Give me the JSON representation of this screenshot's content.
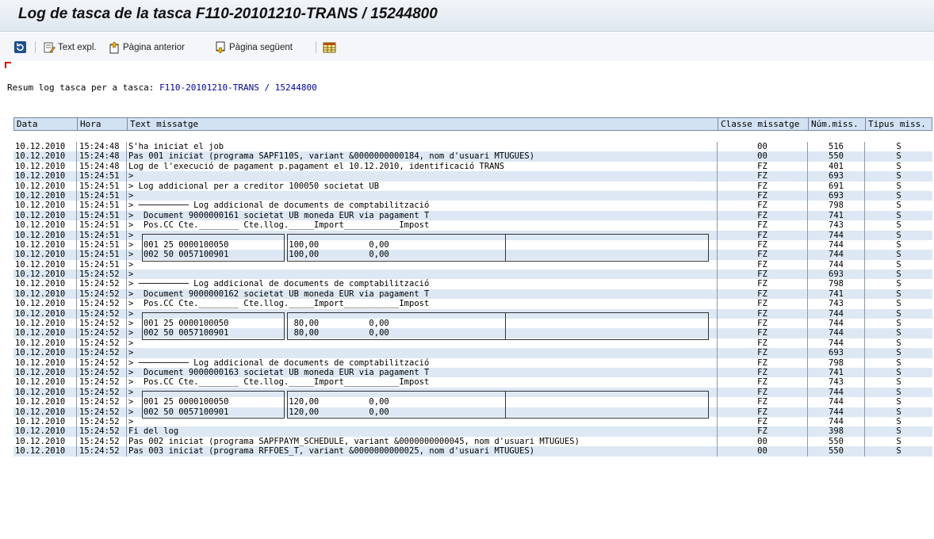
{
  "window": {
    "title": "Log de tasca de la tasca F110-20101210-TRANS / 15244800"
  },
  "toolbar": {
    "refresh_icon": "refresh-icon",
    "text_expl": "Text expl.",
    "prev_page": "Pàgina anterior",
    "next_page": "Pàgina següent",
    "grid_icon": "grid-icon"
  },
  "summary": {
    "label": "Resum log tasca per a tasca: ",
    "value": "F110-20101210-TRANS / 15244800"
  },
  "columns": [
    "Data",
    "Hora",
    "Text missatge",
    "Classe missatge",
    "Núm.miss.",
    "Tipus miss."
  ],
  "rows": [
    {
      "date": "10.12.2010",
      "time": "15:24:48",
      "text": "S'ha iniciat el job",
      "cls": "00",
      "num": "516",
      "type": "S"
    },
    {
      "date": "10.12.2010",
      "time": "15:24:48",
      "text": "Pas 001 iniciat (programa SAPF110S, variant &0000000000184, nom d'usuari MTUGUES)",
      "cls": "00",
      "num": "550",
      "type": "S"
    },
    {
      "date": "10.12.2010",
      "time": "15:24:48",
      "text": "Log de l'execució de pagament p.pagament el 10.12.2010, identificació TRANS",
      "cls": "FZ",
      "num": "401",
      "type": "S"
    },
    {
      "date": "10.12.2010",
      "time": "15:24:51",
      "text": ">",
      "cls": "FZ",
      "num": "693",
      "type": "S"
    },
    {
      "date": "10.12.2010",
      "time": "15:24:51",
      "text": "> Log addicional per a creditor 100050 societat UB",
      "cls": "FZ",
      "num": "691",
      "type": "S"
    },
    {
      "date": "10.12.2010",
      "time": "15:24:51",
      "text": ">",
      "cls": "FZ",
      "num": "693",
      "type": "S"
    },
    {
      "date": "10.12.2010",
      "time": "15:24:51",
      "text": "> ────────── Log addicional de documents de comptabilització",
      "cls": "FZ",
      "num": "798",
      "type": "S"
    },
    {
      "date": "10.12.2010",
      "time": "15:24:51",
      "text": ">  Document 9000000161 societat UB moneda EUR via pagament T",
      "cls": "FZ",
      "num": "741",
      "type": "S"
    },
    {
      "date": "10.12.2010",
      "time": "15:24:51",
      "text": ">  Pos.CC Cte.________ Cte.llog._____Import___________Impost",
      "cls": "FZ",
      "num": "743",
      "type": "S"
    },
    {
      "date": "10.12.2010",
      "time": "15:24:51",
      "text": ">",
      "cls": "FZ",
      "num": "744",
      "type": "S"
    },
    {
      "date": "10.12.2010",
      "time": "15:24:51",
      "text": ">  001 25 0000100050            100,00          0,00",
      "cls": "FZ",
      "num": "744",
      "type": "S"
    },
    {
      "date": "10.12.2010",
      "time": "15:24:51",
      "text": ">  002 50 0057100901            100,00          0,00",
      "cls": "FZ",
      "num": "744",
      "type": "S"
    },
    {
      "date": "10.12.2010",
      "time": "15:24:51",
      "text": ">",
      "cls": "FZ",
      "num": "744",
      "type": "S"
    },
    {
      "date": "10.12.2010",
      "time": "15:24:52",
      "text": ">",
      "cls": "FZ",
      "num": "693",
      "type": "S"
    },
    {
      "date": "10.12.2010",
      "time": "15:24:52",
      "text": "> ────────── Log addicional de documents de comptabilització",
      "cls": "FZ",
      "num": "798",
      "type": "S"
    },
    {
      "date": "10.12.2010",
      "time": "15:24:52",
      "text": ">  Document 9000000162 societat UB moneda EUR via pagament T",
      "cls": "FZ",
      "num": "741",
      "type": "S"
    },
    {
      "date": "10.12.2010",
      "time": "15:24:52",
      "text": ">  Pos.CC Cte.________ Cte.llog._____Import___________Impost",
      "cls": "FZ",
      "num": "743",
      "type": "S"
    },
    {
      "date": "10.12.2010",
      "time": "15:24:52",
      "text": ">",
      "cls": "FZ",
      "num": "744",
      "type": "S"
    },
    {
      "date": "10.12.2010",
      "time": "15:24:52",
      "text": ">  001 25 0000100050             80,00          0,00",
      "cls": "FZ",
      "num": "744",
      "type": "S"
    },
    {
      "date": "10.12.2010",
      "time": "15:24:52",
      "text": ">  002 50 0057100901             80,00          0,00",
      "cls": "FZ",
      "num": "744",
      "type": "S"
    },
    {
      "date": "10.12.2010",
      "time": "15:24:52",
      "text": ">",
      "cls": "FZ",
      "num": "744",
      "type": "S"
    },
    {
      "date": "10.12.2010",
      "time": "15:24:52",
      "text": ">",
      "cls": "FZ",
      "num": "693",
      "type": "S"
    },
    {
      "date": "10.12.2010",
      "time": "15:24:52",
      "text": "> ────────── Log addicional de documents de comptabilització",
      "cls": "FZ",
      "num": "798",
      "type": "S"
    },
    {
      "date": "10.12.2010",
      "time": "15:24:52",
      "text": ">  Document 9000000163 societat UB moneda EUR via pagament T",
      "cls": "FZ",
      "num": "741",
      "type": "S"
    },
    {
      "date": "10.12.2010",
      "time": "15:24:52",
      "text": ">  Pos.CC Cte.________ Cte.llog._____Import___________Impost",
      "cls": "FZ",
      "num": "743",
      "type": "S"
    },
    {
      "date": "10.12.2010",
      "time": "15:24:52",
      "text": ">",
      "cls": "FZ",
      "num": "744",
      "type": "S"
    },
    {
      "date": "10.12.2010",
      "time": "15:24:52",
      "text": ">  001 25 0000100050            120,00          0,00",
      "cls": "FZ",
      "num": "744",
      "type": "S"
    },
    {
      "date": "10.12.2010",
      "time": "15:24:52",
      "text": ">  002 50 0057100901            120,00          0,00",
      "cls": "FZ",
      "num": "744",
      "type": "S"
    },
    {
      "date": "10.12.2010",
      "time": "15:24:52",
      "text": ">",
      "cls": "FZ",
      "num": "744",
      "type": "S"
    },
    {
      "date": "10.12.2010",
      "time": "15:24:52",
      "text": "Fi del log",
      "cls": "FZ",
      "num": "398",
      "type": "S"
    },
    {
      "date": "10.12.2010",
      "time": "15:24:52",
      "text": "Pas 002 iniciat (programa SAPFPAYM_SCHEDULE, variant &0000000000045, nom d'usuari MTUGUES)",
      "cls": "00",
      "num": "550",
      "type": "S"
    },
    {
      "date": "10.12.2010",
      "time": "15:24:52",
      "text": "Pas 003 iniciat (programa RFFOES_T, variant &0000000000025, nom d'usuari MTUGUES)",
      "cls": "00",
      "num": "550",
      "type": "S"
    }
  ],
  "colors": {
    "header_bg": "#d2e2f3",
    "row_alt": "#dde8f4",
    "title_bg": "#e6ecf3",
    "summary_ref": "#0000aa"
  }
}
